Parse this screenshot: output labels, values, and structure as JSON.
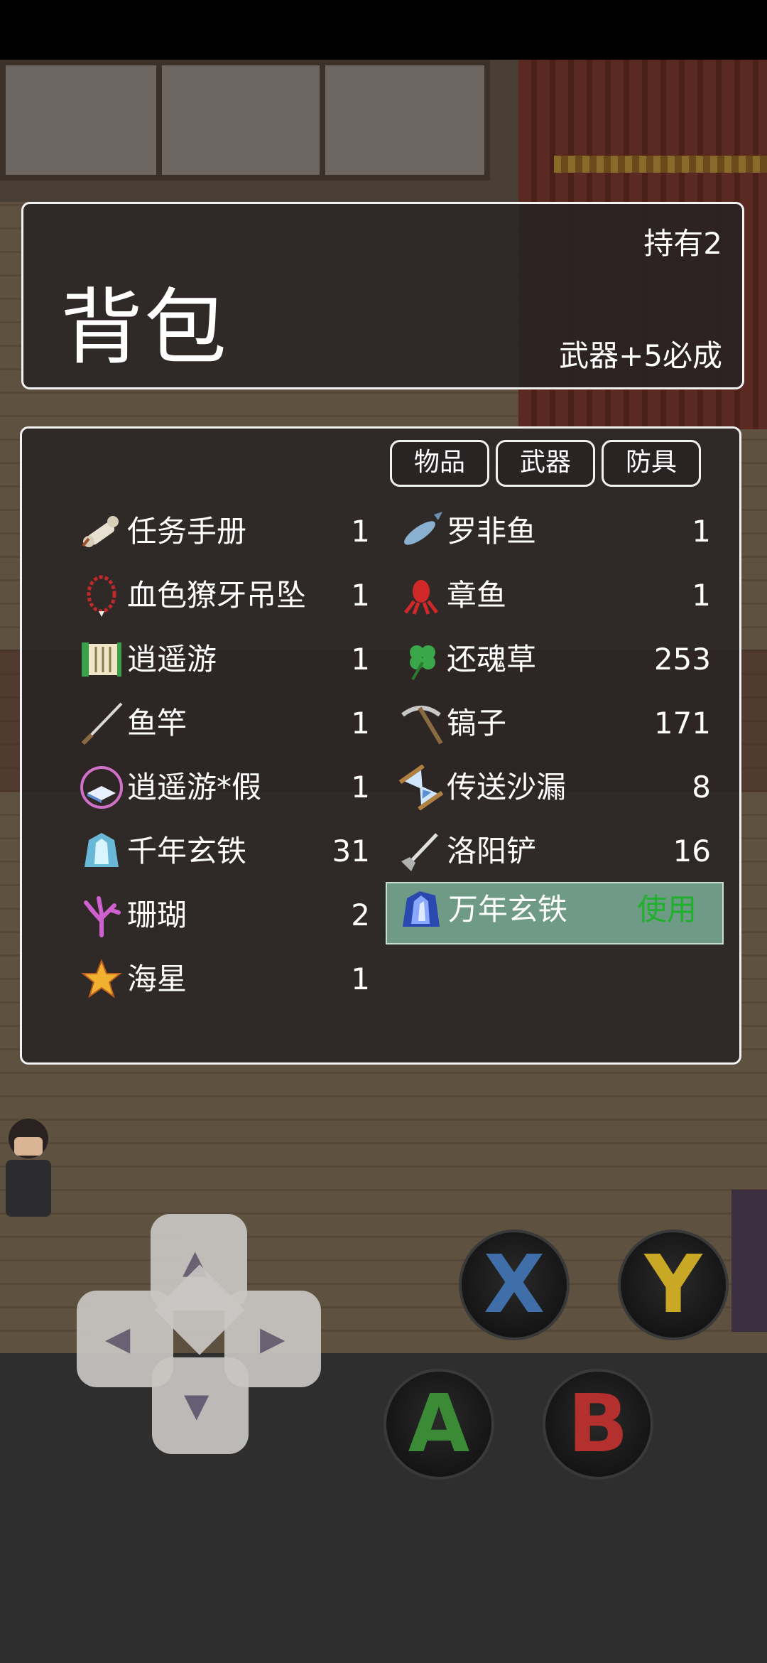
{
  "header": {
    "title": "背包",
    "owned": "持有2",
    "bonus": "武器+5必成"
  },
  "tabs": [
    "物品",
    "武器",
    "防具"
  ],
  "items_left": [
    {
      "name": "任务手册",
      "qty": "1",
      "icon": "scroll-icon"
    },
    {
      "name": "血色獠牙吊坠",
      "qty": "1",
      "icon": "fang-necklace-icon"
    },
    {
      "name": "逍遥游",
      "qty": "1",
      "icon": "bamboo-scroll-icon"
    },
    {
      "name": "鱼竿",
      "qty": "1",
      "icon": "fishing-rod-icon"
    },
    {
      "name": "逍遥游*假",
      "qty": "1",
      "icon": "book-icon"
    },
    {
      "name": "千年玄铁",
      "qty": "31",
      "icon": "iron-ore-icon"
    },
    {
      "name": "珊瑚",
      "qty": "2",
      "icon": "coral-icon"
    },
    {
      "name": "海星",
      "qty": "1",
      "icon": "starfish-icon"
    }
  ],
  "items_right": [
    {
      "name": "罗非鱼",
      "qty": "1",
      "icon": "fish-icon"
    },
    {
      "name": "章鱼",
      "qty": "1",
      "icon": "octopus-icon"
    },
    {
      "name": "还魂草",
      "qty": "253",
      "icon": "herb-icon"
    },
    {
      "name": "镐子",
      "qty": "171",
      "icon": "pickaxe-icon"
    },
    {
      "name": "传送沙漏",
      "qty": "8",
      "icon": "hourglass-icon"
    },
    {
      "name": "洛阳铲",
      "qty": "16",
      "icon": "shovel-icon"
    }
  ],
  "selected_item": {
    "name": "万年玄铁",
    "action": "使用",
    "icon": "crystal-ore-icon"
  },
  "controls": {
    "x": "X",
    "y": "Y",
    "a": "A",
    "b": "B",
    "arrow_up": "▲",
    "arrow_down": "▼",
    "arrow_left": "◀",
    "arrow_right": "▶"
  },
  "colors": {
    "selected_bg": "#6f9a86",
    "use_text": "#1fb02c",
    "x_button": "#3f6ea8",
    "y_button": "#c9a826",
    "a_button": "#3b8a35",
    "b_button": "#b3302e"
  }
}
